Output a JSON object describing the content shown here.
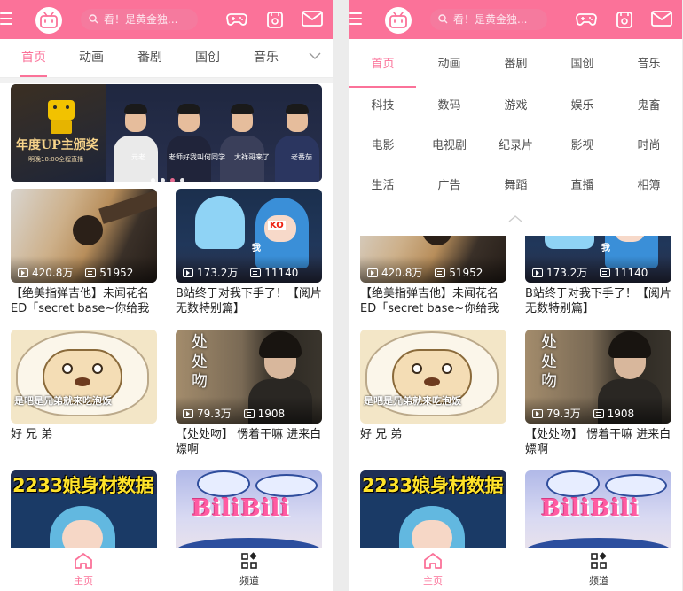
{
  "header": {
    "search_placeholder": "看！是黄金独..."
  },
  "tabs": [
    "首页",
    "动画",
    "番剧",
    "国创",
    "音乐"
  ],
  "banner": {
    "title": "年度UP主颁奖",
    "subtitle": "明晚18:00全程直播",
    "captions": [
      "元老",
      "老师好我叫何同学",
      "大祥哥来了",
      "老番茄"
    ]
  },
  "videos": [
    {
      "title": "【绝美指弹吉他】未闻花名ED「secret base~你给我的所",
      "views": "420.8万",
      "danmaku": "51952"
    },
    {
      "title": "B站终于对我下手了！【阅片无数特别篇】",
      "views": "173.2万",
      "danmaku": "11140"
    },
    {
      "title": "好 兄 弟",
      "views": "",
      "danmaku": "",
      "overlay_text": "是吧是兄弟就来吃泡饭"
    },
    {
      "title": "【处处吻】 愣着干嘛 进来白嫖啊",
      "views": "79.3万",
      "danmaku": "1908",
      "calligraphy": "处处吻"
    },
    {
      "title": "",
      "views": "",
      "danmaku": "",
      "headline": "2233娘身材数据"
    },
    {
      "title": "",
      "views": "",
      "danmaku": "",
      "logo_text": "BiliBili"
    }
  ],
  "channels": [
    [
      "首页",
      "动画",
      "番剧",
      "国创",
      "音乐"
    ],
    [
      "科技",
      "数码",
      "游戏",
      "娱乐",
      "鬼畜"
    ],
    [
      "电影",
      "电视剧",
      "纪录片",
      "影视",
      "时尚"
    ],
    [
      "生活",
      "广告",
      "舞蹈",
      "直播",
      "相簿"
    ]
  ],
  "bottom_nav": {
    "home": "主页",
    "channels": "频道"
  },
  "colors": {
    "brand_pink": "#fb7299",
    "text_gray": "#505050"
  }
}
